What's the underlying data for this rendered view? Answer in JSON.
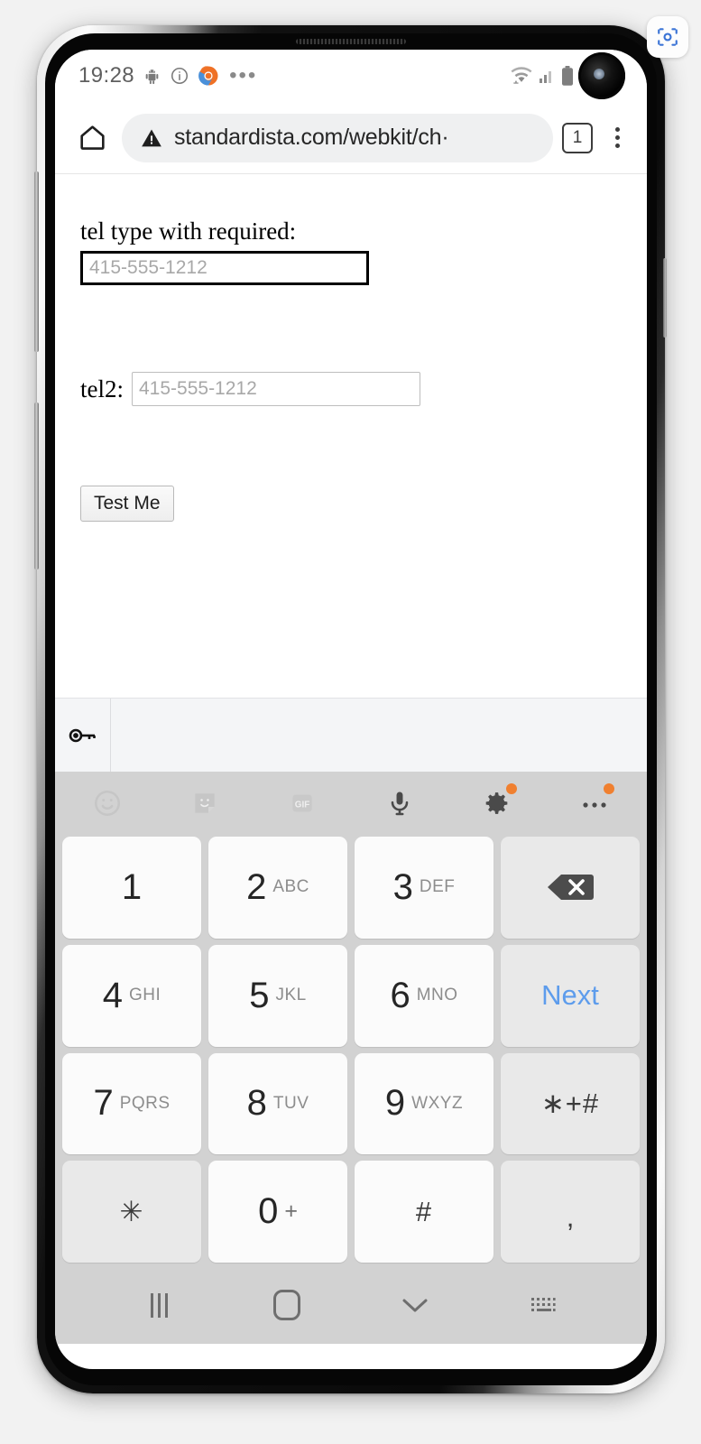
{
  "capture_badge": {
    "icon": "screenshot-capture-icon"
  },
  "status_bar": {
    "clock": "19:28",
    "left_icons": [
      "android-debug-icon",
      "info-circle-icon",
      "chrome-icon"
    ],
    "overflow": "•••",
    "right_icons": [
      "wifi-icon",
      "cellular-signal-icon",
      "battery-icon"
    ]
  },
  "browser": {
    "home_icon": "home-icon",
    "security_icon": "not-secure-warning-icon",
    "url": "standardista.com/webkit/ch·",
    "tab_count": "1",
    "menu_icon": "overflow-menu-icon"
  },
  "webpage": {
    "tel1_label": "tel type with required:",
    "tel1_placeholder": "415-555-1212",
    "tel1_value": "",
    "tel2_label": "tel2:",
    "tel2_placeholder": "415-555-1212",
    "tel2_value": "",
    "submit_label": "Test Me"
  },
  "autofill_strip": {
    "key_icon": "password-key-icon"
  },
  "keyboard": {
    "toolbar": [
      {
        "name": "emoji-icon",
        "badge": false
      },
      {
        "name": "sticker-icon",
        "badge": false
      },
      {
        "name": "gif-icon",
        "badge": false,
        "label": "GIF"
      },
      {
        "name": "microphone-icon",
        "badge": false
      },
      {
        "name": "keyboard-settings-icon",
        "badge": true
      },
      {
        "name": "keyboard-more-icon",
        "badge": true
      }
    ],
    "rows": [
      [
        {
          "name": "key-1",
          "num": "1",
          "letters": "",
          "type": "digit"
        },
        {
          "name": "key-2",
          "num": "2",
          "letters": "ABC",
          "type": "digit"
        },
        {
          "name": "key-3",
          "num": "3",
          "letters": "DEF",
          "type": "digit"
        },
        {
          "name": "key-backspace",
          "icon": "backspace-icon",
          "type": "func"
        }
      ],
      [
        {
          "name": "key-4",
          "num": "4",
          "letters": "GHI",
          "type": "digit"
        },
        {
          "name": "key-5",
          "num": "5",
          "letters": "JKL",
          "type": "digit"
        },
        {
          "name": "key-6",
          "num": "6",
          "letters": "MNO",
          "type": "digit"
        },
        {
          "name": "key-next",
          "label": "Next",
          "type": "next"
        }
      ],
      [
        {
          "name": "key-7",
          "num": "7",
          "letters": "PQRS",
          "type": "digit"
        },
        {
          "name": "key-8",
          "num": "8",
          "letters": "TUV",
          "type": "digit"
        },
        {
          "name": "key-9",
          "num": "9",
          "letters": "WXYZ",
          "type": "digit"
        },
        {
          "name": "key-symbols",
          "sym": "∗+#",
          "type": "func"
        }
      ],
      [
        {
          "name": "key-asterisk",
          "sym": "✳",
          "type": "func"
        },
        {
          "name": "key-0",
          "num": "0",
          "plus": "+",
          "type": "digit"
        },
        {
          "name": "key-hash",
          "sym": "#",
          "type": "digit"
        },
        {
          "name": "key-comma",
          "sym": ",",
          "type": "func"
        }
      ]
    ],
    "next_color": "#5d9cec",
    "badge_color": "#f08030"
  },
  "navbar": {
    "items": [
      "recents-icon",
      "home-icon",
      "hide-keyboard-chevron-icon",
      "switch-keyboard-icon"
    ]
  }
}
